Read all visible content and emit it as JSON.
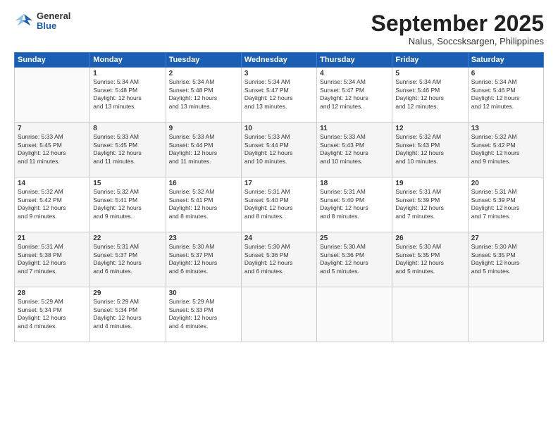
{
  "header": {
    "logo": {
      "general": "General",
      "blue": "Blue"
    },
    "title": "September 2025",
    "subtitle": "Nalus, Soccsksargen, Philippines"
  },
  "days_of_week": [
    "Sunday",
    "Monday",
    "Tuesday",
    "Wednesday",
    "Thursday",
    "Friday",
    "Saturday"
  ],
  "weeks": [
    [
      {
        "num": "",
        "info": ""
      },
      {
        "num": "1",
        "info": "Sunrise: 5:34 AM\nSunset: 5:48 PM\nDaylight: 12 hours\nand 13 minutes."
      },
      {
        "num": "2",
        "info": "Sunrise: 5:34 AM\nSunset: 5:48 PM\nDaylight: 12 hours\nand 13 minutes."
      },
      {
        "num": "3",
        "info": "Sunrise: 5:34 AM\nSunset: 5:47 PM\nDaylight: 12 hours\nand 13 minutes."
      },
      {
        "num": "4",
        "info": "Sunrise: 5:34 AM\nSunset: 5:47 PM\nDaylight: 12 hours\nand 12 minutes."
      },
      {
        "num": "5",
        "info": "Sunrise: 5:34 AM\nSunset: 5:46 PM\nDaylight: 12 hours\nand 12 minutes."
      },
      {
        "num": "6",
        "info": "Sunrise: 5:34 AM\nSunset: 5:46 PM\nDaylight: 12 hours\nand 12 minutes."
      }
    ],
    [
      {
        "num": "7",
        "info": "Sunrise: 5:33 AM\nSunset: 5:45 PM\nDaylight: 12 hours\nand 11 minutes."
      },
      {
        "num": "8",
        "info": "Sunrise: 5:33 AM\nSunset: 5:45 PM\nDaylight: 12 hours\nand 11 minutes."
      },
      {
        "num": "9",
        "info": "Sunrise: 5:33 AM\nSunset: 5:44 PM\nDaylight: 12 hours\nand 11 minutes."
      },
      {
        "num": "10",
        "info": "Sunrise: 5:33 AM\nSunset: 5:44 PM\nDaylight: 12 hours\nand 10 minutes."
      },
      {
        "num": "11",
        "info": "Sunrise: 5:33 AM\nSunset: 5:43 PM\nDaylight: 12 hours\nand 10 minutes."
      },
      {
        "num": "12",
        "info": "Sunrise: 5:32 AM\nSunset: 5:43 PM\nDaylight: 12 hours\nand 10 minutes."
      },
      {
        "num": "13",
        "info": "Sunrise: 5:32 AM\nSunset: 5:42 PM\nDaylight: 12 hours\nand 9 minutes."
      }
    ],
    [
      {
        "num": "14",
        "info": "Sunrise: 5:32 AM\nSunset: 5:42 PM\nDaylight: 12 hours\nand 9 minutes."
      },
      {
        "num": "15",
        "info": "Sunrise: 5:32 AM\nSunset: 5:41 PM\nDaylight: 12 hours\nand 9 minutes."
      },
      {
        "num": "16",
        "info": "Sunrise: 5:32 AM\nSunset: 5:41 PM\nDaylight: 12 hours\nand 8 minutes."
      },
      {
        "num": "17",
        "info": "Sunrise: 5:31 AM\nSunset: 5:40 PM\nDaylight: 12 hours\nand 8 minutes."
      },
      {
        "num": "18",
        "info": "Sunrise: 5:31 AM\nSunset: 5:40 PM\nDaylight: 12 hours\nand 8 minutes."
      },
      {
        "num": "19",
        "info": "Sunrise: 5:31 AM\nSunset: 5:39 PM\nDaylight: 12 hours\nand 7 minutes."
      },
      {
        "num": "20",
        "info": "Sunrise: 5:31 AM\nSunset: 5:39 PM\nDaylight: 12 hours\nand 7 minutes."
      }
    ],
    [
      {
        "num": "21",
        "info": "Sunrise: 5:31 AM\nSunset: 5:38 PM\nDaylight: 12 hours\nand 7 minutes."
      },
      {
        "num": "22",
        "info": "Sunrise: 5:31 AM\nSunset: 5:37 PM\nDaylight: 12 hours\nand 6 minutes."
      },
      {
        "num": "23",
        "info": "Sunrise: 5:30 AM\nSunset: 5:37 PM\nDaylight: 12 hours\nand 6 minutes."
      },
      {
        "num": "24",
        "info": "Sunrise: 5:30 AM\nSunset: 5:36 PM\nDaylight: 12 hours\nand 6 minutes."
      },
      {
        "num": "25",
        "info": "Sunrise: 5:30 AM\nSunset: 5:36 PM\nDaylight: 12 hours\nand 5 minutes."
      },
      {
        "num": "26",
        "info": "Sunrise: 5:30 AM\nSunset: 5:35 PM\nDaylight: 12 hours\nand 5 minutes."
      },
      {
        "num": "27",
        "info": "Sunrise: 5:30 AM\nSunset: 5:35 PM\nDaylight: 12 hours\nand 5 minutes."
      }
    ],
    [
      {
        "num": "28",
        "info": "Sunrise: 5:29 AM\nSunset: 5:34 PM\nDaylight: 12 hours\nand 4 minutes."
      },
      {
        "num": "29",
        "info": "Sunrise: 5:29 AM\nSunset: 5:34 PM\nDaylight: 12 hours\nand 4 minutes."
      },
      {
        "num": "30",
        "info": "Sunrise: 5:29 AM\nSunset: 5:33 PM\nDaylight: 12 hours\nand 4 minutes."
      },
      {
        "num": "",
        "info": ""
      },
      {
        "num": "",
        "info": ""
      },
      {
        "num": "",
        "info": ""
      },
      {
        "num": "",
        "info": ""
      }
    ]
  ]
}
